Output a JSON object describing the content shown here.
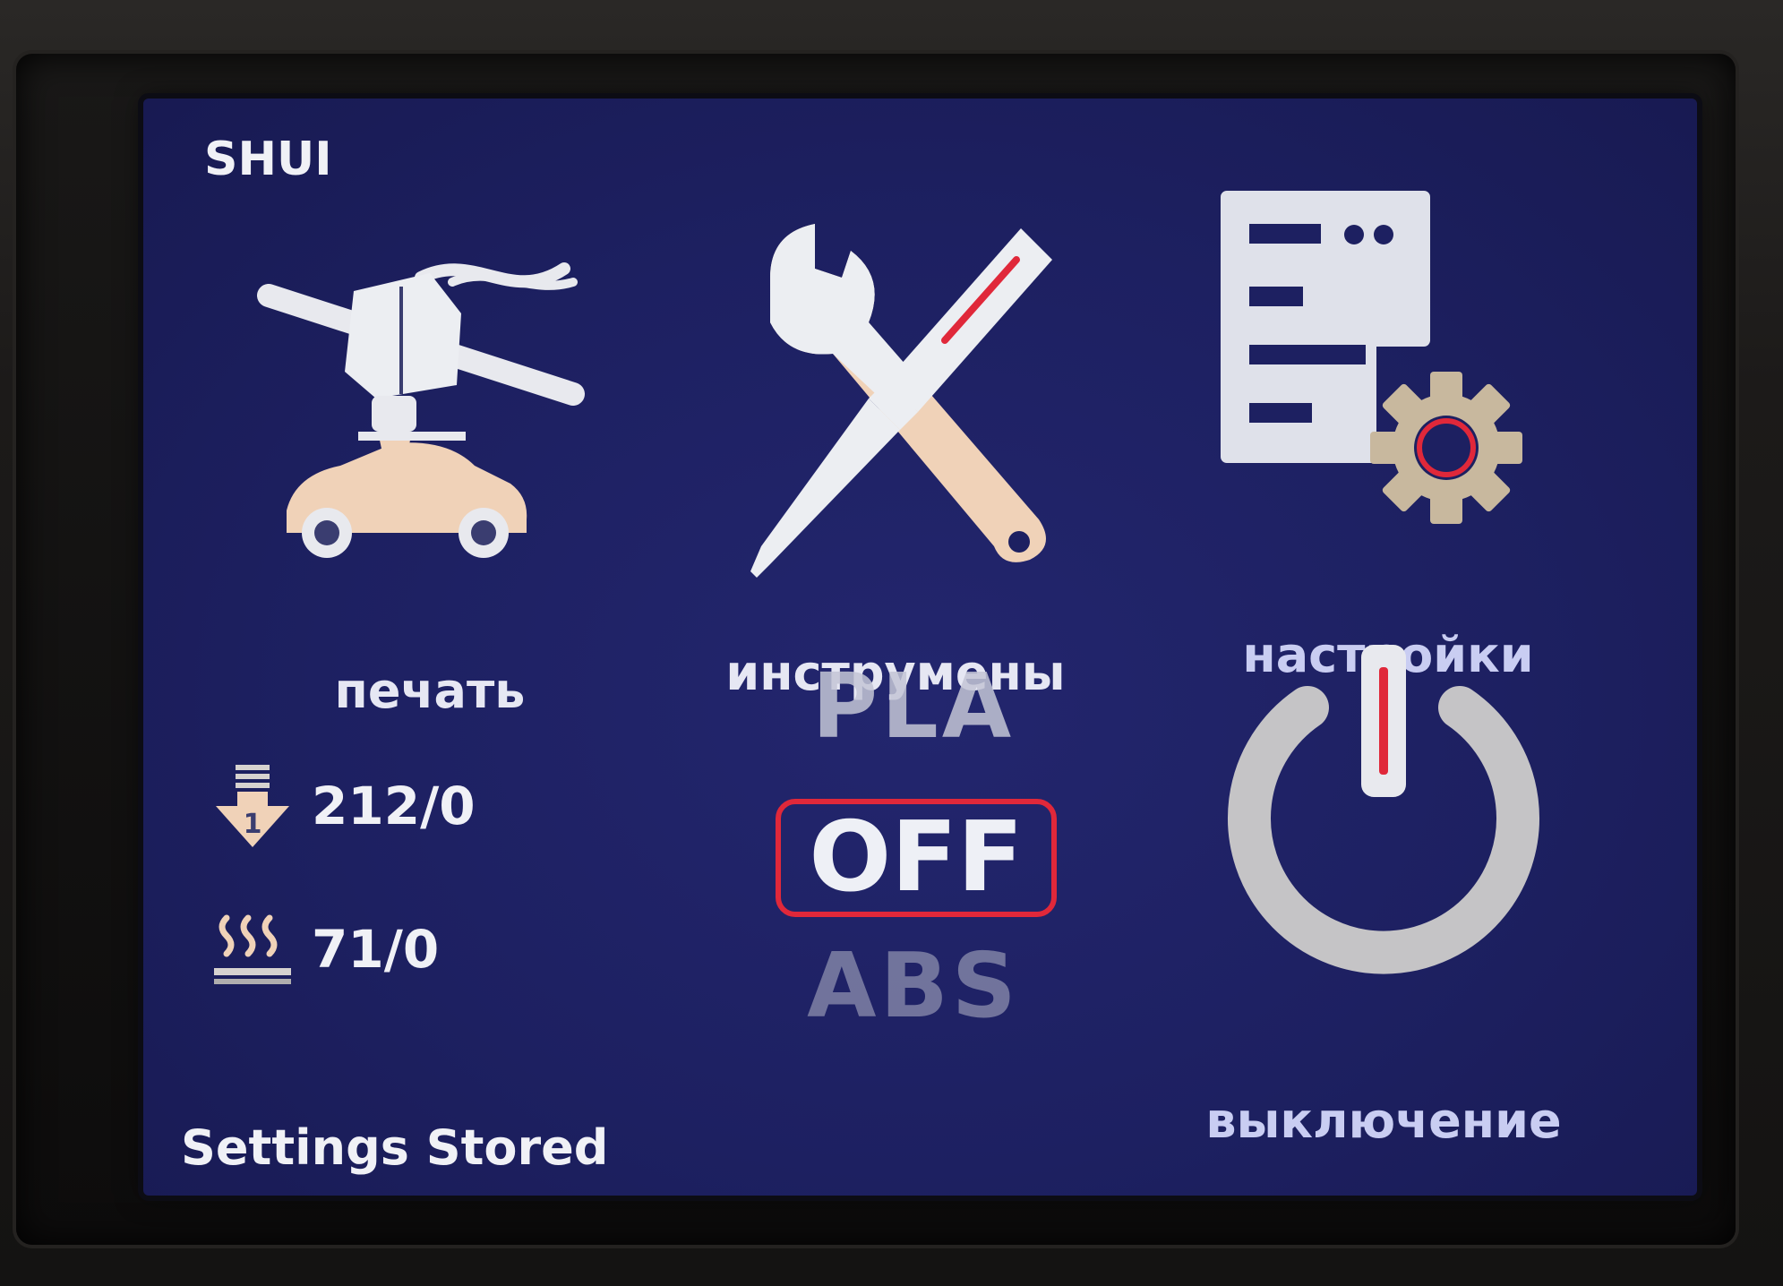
{
  "header": {
    "title": "SHUI"
  },
  "menu": {
    "print_label": "печать",
    "tools_label": "инструмены",
    "settings_label": "настройки",
    "power_label": "выключение"
  },
  "temps": {
    "nozzle": "212/0",
    "nozzle_index": "1",
    "bed": "71/0"
  },
  "preset": {
    "options": [
      "PLA",
      "OFF",
      "ABS"
    ],
    "selected": "OFF"
  },
  "status": "Settings Stored",
  "colors": {
    "screen_bg": "#1d2061",
    "accent_red": "#e0283a",
    "icon_light": "#e8e9ee",
    "icon_peach": "#f0d2b8"
  }
}
